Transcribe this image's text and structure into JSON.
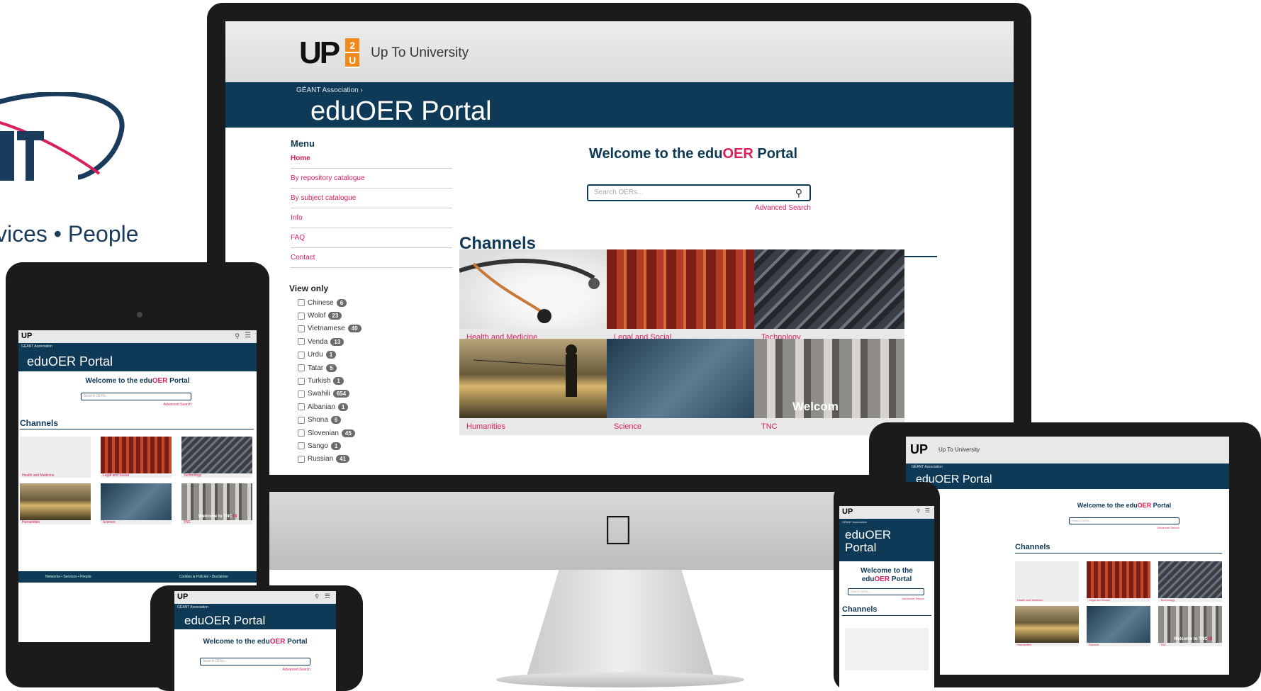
{
  "brand": {
    "tagline": "vices • People"
  },
  "site": {
    "logo_text": "UP",
    "logo_badge_top": "2",
    "logo_badge_bottom": "U",
    "logo_name": "Up To University",
    "breadcrumb": "GÉANT Association",
    "portal_title": "eduOER Portal",
    "welcome_prefix": "Welcome to the edu",
    "welcome_highlight": "OER",
    "welcome_suffix": " Portal",
    "search_placeholder": "Search OERs...",
    "advanced_search": "Advanced Search",
    "channels_title": "Channels"
  },
  "menu": {
    "heading": "Menu",
    "items": [
      {
        "label": "Home"
      },
      {
        "label": "By repository catalogue"
      },
      {
        "label": "By subject catalogue"
      },
      {
        "label": "Info"
      },
      {
        "label": "FAQ"
      },
      {
        "label": "Contact"
      }
    ]
  },
  "view_only": {
    "heading": "View only",
    "languages": [
      {
        "name": "Chinese",
        "count": "6"
      },
      {
        "name": "Wolof",
        "count": "23"
      },
      {
        "name": "Vietnamese",
        "count": "40"
      },
      {
        "name": "Venda",
        "count": "13"
      },
      {
        "name": "Urdu",
        "count": "1"
      },
      {
        "name": "Tatar",
        "count": "5"
      },
      {
        "name": "Turkish",
        "count": "1"
      },
      {
        "name": "Swahili",
        "count": "654"
      },
      {
        "name": "Albanian",
        "count": "1"
      },
      {
        "name": "Shona",
        "count": "6"
      },
      {
        "name": "Slovenian",
        "count": "45"
      },
      {
        "name": "Sango",
        "count": "1"
      },
      {
        "name": "Russian",
        "count": "41"
      }
    ]
  },
  "channels": [
    {
      "label": "Health and Medicine"
    },
    {
      "label": "Legal and Social"
    },
    {
      "label": "Technology"
    },
    {
      "label": "Humanities"
    },
    {
      "label": "Science"
    },
    {
      "label": "TNC"
    }
  ],
  "tnc_overlay": "Welcom",
  "mini": {
    "tnc_overlay": "Welcome to TNC",
    "tnc_year": "18",
    "footer_left": "Networks • Services • People",
    "footer_right": "Cookies & Policies • Disclaimer"
  },
  "colors": {
    "navy": "#0f3a57",
    "accent": "#d91f5e",
    "logo_orange": "#f08a1c"
  }
}
